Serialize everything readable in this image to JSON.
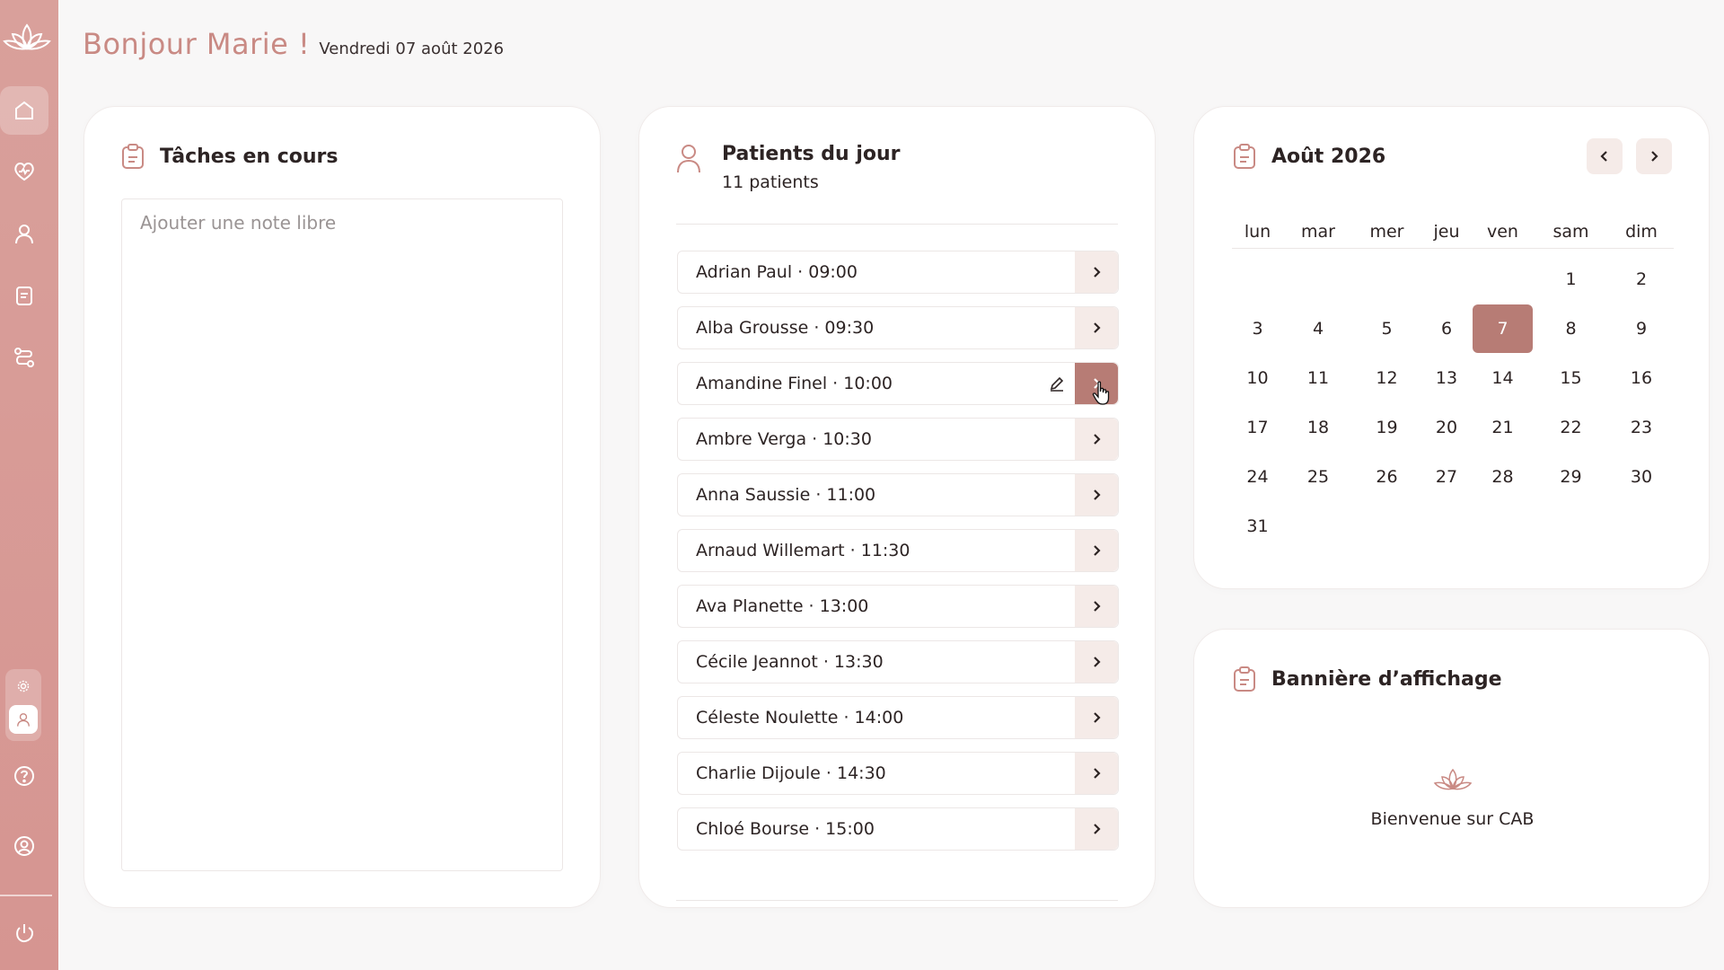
{
  "header": {
    "greeting": "Bonjour Marie !",
    "date": "Vendredi 07 août 2026"
  },
  "sidebar": {
    "items": [
      {
        "icon": "home-icon",
        "active": true
      },
      {
        "icon": "heart-pulse-icon"
      },
      {
        "icon": "user-icon"
      },
      {
        "icon": "document-icon"
      },
      {
        "icon": "route-icon"
      }
    ],
    "bottom": [
      "help-icon",
      "account-icon",
      "power-icon"
    ]
  },
  "tasks": {
    "title": "Tâches en cours",
    "placeholder": "Ajouter une note libre"
  },
  "patients": {
    "title": "Patients du jour",
    "count": "11 patients",
    "list": [
      {
        "label": "Adrian Paul · 09:00"
      },
      {
        "label": "Alba Grousse · 09:30"
      },
      {
        "label": "Amandine Finel · 10:00",
        "hovered": true
      },
      {
        "label": "Ambre Verga · 10:30"
      },
      {
        "label": "Anna Saussie · 11:00"
      },
      {
        "label": "Arnaud Willemart · 11:30"
      },
      {
        "label": "Ava Planette · 13:00"
      },
      {
        "label": "Cécile Jeannot · 13:30"
      },
      {
        "label": "Céleste Noulette · 14:00"
      },
      {
        "label": "Charlie Dijoule · 14:30"
      },
      {
        "label": "Chloé Bourse · 15:00"
      }
    ]
  },
  "calendar": {
    "title": "Août 2026",
    "weekdays": [
      "lun",
      "mar",
      "mer",
      "jeu",
      "ven",
      "sam",
      "dim"
    ],
    "weeks": [
      [
        "",
        "",
        "",
        "",
        "",
        "1",
        "2"
      ],
      [
        "3",
        "4",
        "5",
        "6",
        "7",
        "8",
        "9"
      ],
      [
        "10",
        "11",
        "12",
        "13",
        "14",
        "15",
        "16"
      ],
      [
        "17",
        "18",
        "19",
        "20",
        "21",
        "22",
        "23"
      ],
      [
        "24",
        "25",
        "26",
        "27",
        "28",
        "29",
        "30"
      ],
      [
        "31",
        "",
        "",
        "",
        "",
        "",
        ""
      ]
    ],
    "selected": "7"
  },
  "banner": {
    "title": "Bannière d’affichage",
    "text": "Bienvenue sur CAB"
  },
  "colors": {
    "accent": "#c98a84",
    "selected": "#b77c75",
    "sidebar": "#d69a95",
    "soft": "#f5ebe8"
  }
}
